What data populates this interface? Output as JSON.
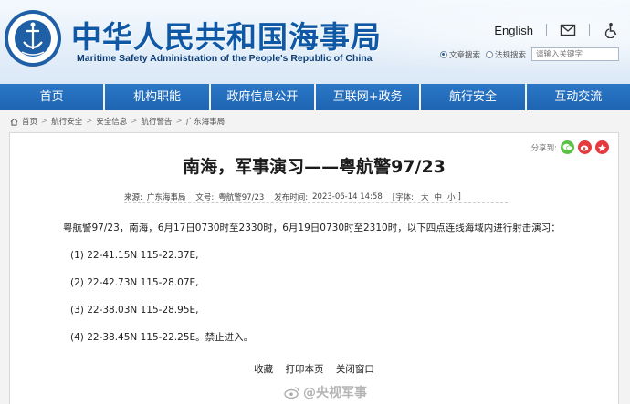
{
  "header": {
    "title": "中华人民共和国海事局",
    "subtitle": "Maritime Safety Administration of the People's Republic of China",
    "logo_text": "CHINA MSA",
    "logo_top_text": "中国海事局",
    "english_link": "English",
    "mail_icon": "mail-icon",
    "accessibility_icon": "accessibility-icon",
    "search_options": [
      "文章搜索",
      "法规搜索"
    ],
    "search_placeholder": "请输入关键字"
  },
  "nav": {
    "items": [
      "首页",
      "机构职能",
      "政府信息公开",
      "互联网+政务",
      "航行安全",
      "互动交流"
    ]
  },
  "breadcrumb": {
    "items": [
      "首页",
      "航行安全",
      "安全信息",
      "航行警告",
      "广东海事局"
    ]
  },
  "article": {
    "share_label": "分享到:",
    "title": "南海，军事演习——粤航警97/23",
    "meta": {
      "source_label": "来源:",
      "source": "广东海事局",
      "docno_label": "文号:",
      "docno": "粤航警97/23",
      "time_label": "发布时间:",
      "time": "2023-06-14 14:58",
      "font_label": "[字体:",
      "font_large": "大",
      "font_medium": "中",
      "font_small": "小",
      "font_end": "]"
    },
    "intro": "粤航警97/23，南海，6月17日0730时至2330时，6月19日0730时至2310时，以下四点连线海域内进行射击演习：",
    "points": [
      "(1)  22-41.15N 115-22.37E,",
      "(2)  22-42.73N 115-28.07E,",
      "(3)  22-38.03N 115-28.95E,",
      "(4)  22-38.45N 115-22.25E。禁止进入。"
    ],
    "footer_links": [
      "收藏",
      "打印本页",
      "关闭窗口"
    ]
  },
  "watermark": "@央视军事",
  "colors": {
    "brand_blue": "#0e58a6",
    "nav_blue": "#1e65b3",
    "wechat_green": "#5cc046",
    "weibo_red": "#e6393e"
  }
}
